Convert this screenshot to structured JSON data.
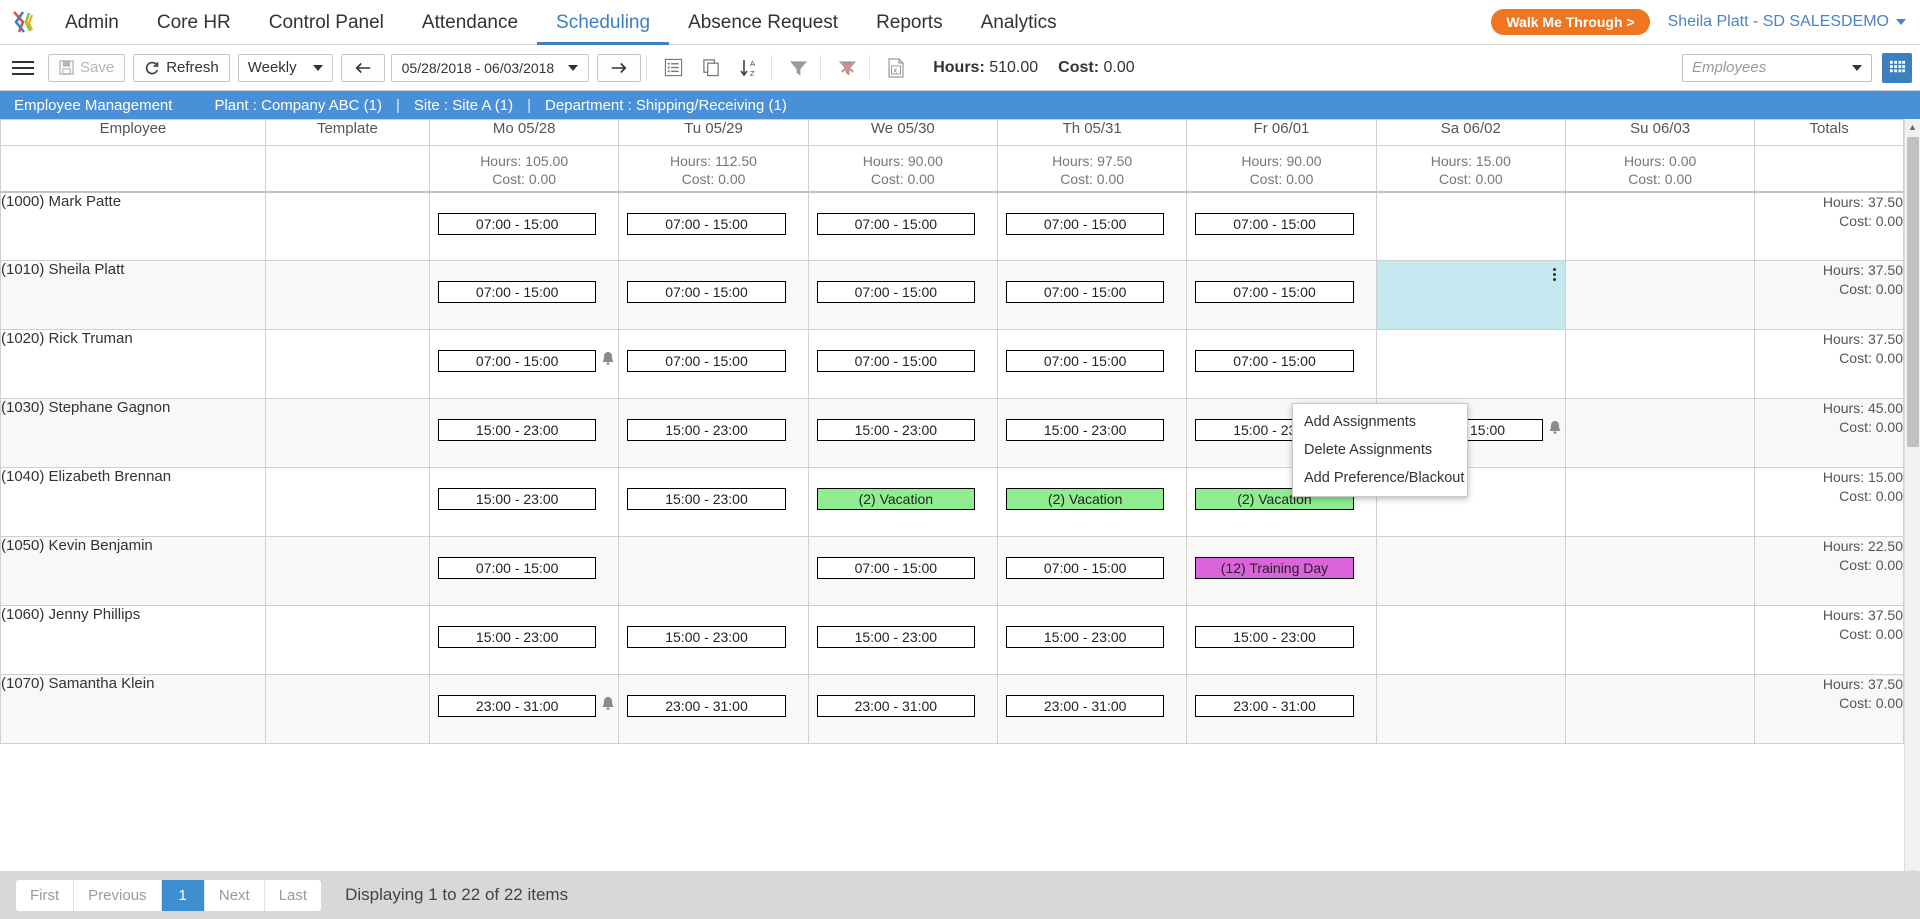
{
  "topnav": {
    "logo_icon": "logo-icon",
    "items": [
      {
        "label": "Admin",
        "active": false
      },
      {
        "label": "Core HR",
        "active": false
      },
      {
        "label": "Control Panel",
        "active": false
      },
      {
        "label": "Attendance",
        "active": false
      },
      {
        "label": "Scheduling",
        "active": true
      },
      {
        "label": "Absence Request",
        "active": false
      },
      {
        "label": "Reports",
        "active": false
      },
      {
        "label": "Analytics",
        "active": false
      }
    ],
    "walk_me_through": "Walk Me Through >",
    "user": "Sheila Platt - SD SALESDEMO"
  },
  "toolbar": {
    "menu_icon": "hamburger-icon",
    "save_label": "Save",
    "refresh_label": "Refresh",
    "view_mode": "Weekly",
    "prev_icon": "arrow-left-icon",
    "date_range": "05/28/2018 - 06/03/2018",
    "next_icon": "arrow-right-icon",
    "list_icon": "list-view-icon",
    "copy_icon": "copy-icon",
    "sort_icon": "sort-az-icon",
    "filter_icon": "filter-icon",
    "clear_filter_icon": "clear-filter-icon",
    "excel_icon": "excel-export-icon",
    "hours_label": "Hours:",
    "hours_value": "510.00",
    "cost_label": "Cost:",
    "cost_value": "0.00",
    "employees_placeholder": "Employees",
    "grid_icon": "grid-view-icon"
  },
  "breadcrumb": {
    "title": "Employee Management",
    "plant": "Plant : Company ABC (1)",
    "site": "Site : Site A (1)",
    "department": "Department : Shipping/Receiving (1)",
    "divider": "|"
  },
  "grid": {
    "columns": [
      "Employee",
      "Template",
      "Mo 05/28",
      "Tu 05/29",
      "We 05/30",
      "Th 05/31",
      "Fr 06/01",
      "Sa 06/02",
      "Su 06/03",
      "Totals"
    ],
    "day_summaries": [
      {
        "hours": "Hours: 105.00",
        "cost": "Cost: 0.00"
      },
      {
        "hours": "Hours: 112.50",
        "cost": "Cost: 0.00"
      },
      {
        "hours": "Hours: 90.00",
        "cost": "Cost: 0.00"
      },
      {
        "hours": "Hours: 97.50",
        "cost": "Cost: 0.00"
      },
      {
        "hours": "Hours: 90.00",
        "cost": "Cost: 0.00"
      },
      {
        "hours": "Hours: 15.00",
        "cost": "Cost: 0.00"
      },
      {
        "hours": "Hours: 0.00",
        "cost": "Cost: 0.00"
      }
    ],
    "rows": [
      {
        "employee": "(1000) Mark Patte",
        "template": "",
        "days": [
          {
            "text": "07:00 - 15:00",
            "type": "shift"
          },
          {
            "text": "07:00 - 15:00",
            "type": "shift"
          },
          {
            "text": "07:00 - 15:00",
            "type": "shift"
          },
          {
            "text": "07:00 - 15:00",
            "type": "shift"
          },
          {
            "text": "07:00 - 15:00",
            "type": "shift"
          },
          {
            "text": "",
            "type": "empty"
          },
          {
            "text": "",
            "type": "empty"
          }
        ],
        "total_hours": "Hours: 37.50",
        "total_cost": "Cost: 0.00"
      },
      {
        "employee": "(1010) Sheila Platt",
        "template": "",
        "days": [
          {
            "text": "07:00 - 15:00",
            "type": "shift"
          },
          {
            "text": "07:00 - 15:00",
            "type": "shift"
          },
          {
            "text": "07:00 - 15:00",
            "type": "shift"
          },
          {
            "text": "07:00 - 15:00",
            "type": "shift"
          },
          {
            "text": "07:00 - 15:00",
            "type": "shift"
          },
          {
            "text": "",
            "type": "selected"
          },
          {
            "text": "",
            "type": "empty"
          }
        ],
        "total_hours": "Hours: 37.50",
        "total_cost": "Cost: 0.00"
      },
      {
        "employee": "(1020) Rick Truman",
        "template": "",
        "days": [
          {
            "text": "07:00 - 15:00",
            "type": "shift",
            "alert": true
          },
          {
            "text": "07:00 - 15:00",
            "type": "shift"
          },
          {
            "text": "07:00 - 15:00",
            "type": "shift"
          },
          {
            "text": "07:00 - 15:00",
            "type": "shift"
          },
          {
            "text": "07:00 - 15:00",
            "type": "shift"
          },
          {
            "text": "",
            "type": "empty"
          },
          {
            "text": "",
            "type": "empty"
          }
        ],
        "total_hours": "Hours: 37.50",
        "total_cost": "Cost: 0.00"
      },
      {
        "employee": "(1030) Stephane Gagnon",
        "template": "",
        "days": [
          {
            "text": "15:00 - 23:00",
            "type": "shift"
          },
          {
            "text": "15:00 - 23:00",
            "type": "shift"
          },
          {
            "text": "15:00 - 23:00",
            "type": "shift"
          },
          {
            "text": "15:00 - 23:00",
            "type": "shift"
          },
          {
            "text": "15:00 - 23:00",
            "type": "shift"
          },
          {
            "text": "07:00 - 15:00",
            "type": "shift",
            "alert": true
          },
          {
            "text": "",
            "type": "empty"
          }
        ],
        "total_hours": "Hours: 45.00",
        "total_cost": "Cost: 0.00"
      },
      {
        "employee": "(1040) Elizabeth Brennan",
        "template": "",
        "days": [
          {
            "text": "15:00 - 23:00",
            "type": "shift"
          },
          {
            "text": "15:00 - 23:00",
            "type": "shift"
          },
          {
            "text": "(2) Vacation",
            "type": "vacation"
          },
          {
            "text": "(2) Vacation",
            "type": "vacation"
          },
          {
            "text": "(2) Vacation",
            "type": "vacation"
          },
          {
            "text": "",
            "type": "empty"
          },
          {
            "text": "",
            "type": "empty"
          }
        ],
        "total_hours": "Hours: 15.00",
        "total_cost": "Cost: 0.00"
      },
      {
        "employee": "(1050) Kevin Benjamin",
        "template": "",
        "days": [
          {
            "text": "07:00 - 15:00",
            "type": "shift"
          },
          {
            "text": "",
            "type": "empty"
          },
          {
            "text": "07:00 - 15:00",
            "type": "shift"
          },
          {
            "text": "07:00 - 15:00",
            "type": "shift"
          },
          {
            "text": "(12) Training Day",
            "type": "training"
          },
          {
            "text": "",
            "type": "empty"
          },
          {
            "text": "",
            "type": "empty"
          }
        ],
        "total_hours": "Hours: 22.50",
        "total_cost": "Cost: 0.00"
      },
      {
        "employee": "(1060) Jenny Phillips",
        "template": "",
        "days": [
          {
            "text": "15:00 - 23:00",
            "type": "shift"
          },
          {
            "text": "15:00 - 23:00",
            "type": "shift"
          },
          {
            "text": "15:00 - 23:00",
            "type": "shift"
          },
          {
            "text": "15:00 - 23:00",
            "type": "shift"
          },
          {
            "text": "15:00 - 23:00",
            "type": "shift"
          },
          {
            "text": "",
            "type": "empty"
          },
          {
            "text": "",
            "type": "empty"
          }
        ],
        "total_hours": "Hours: 37.50",
        "total_cost": "Cost: 0.00"
      },
      {
        "employee": "(1070) Samantha Klein",
        "template": "",
        "days": [
          {
            "text": "23:00 - 31:00",
            "type": "shift",
            "alert": true
          },
          {
            "text": "23:00 - 31:00",
            "type": "shift"
          },
          {
            "text": "23:00 - 31:00",
            "type": "shift"
          },
          {
            "text": "23:00 - 31:00",
            "type": "shift"
          },
          {
            "text": "23:00 - 31:00",
            "type": "shift"
          },
          {
            "text": "",
            "type": "empty"
          },
          {
            "text": "",
            "type": "empty"
          }
        ],
        "total_hours": "Hours: 37.50",
        "total_cost": "Cost: 0.00"
      }
    ]
  },
  "context_menu": {
    "items": [
      "Add Assignments",
      "Delete Assignments",
      "Add Preference/Blackout"
    ]
  },
  "footer": {
    "first": "First",
    "previous": "Previous",
    "page": "1",
    "next": "Next",
    "last": "Last",
    "displaying": "Displaying 1 to 22 of 22 items"
  }
}
